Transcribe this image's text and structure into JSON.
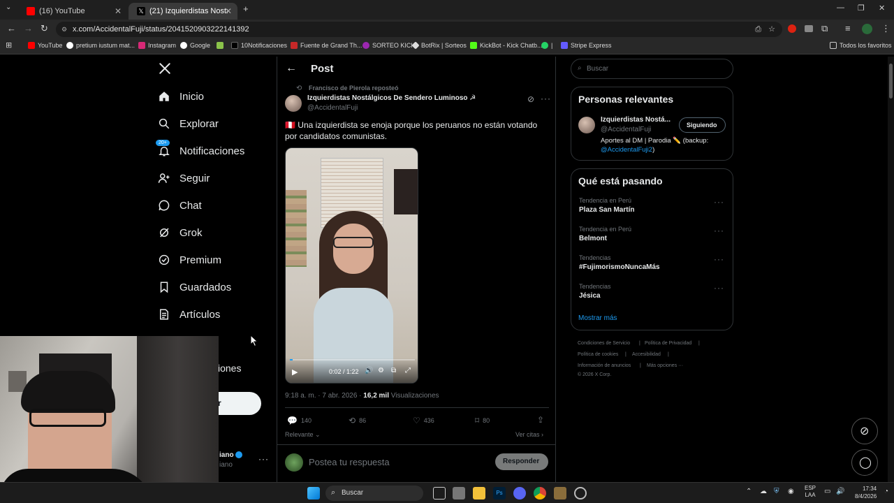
{
  "tabs": [
    {
      "label": "(16) YouTube",
      "active": false
    },
    {
      "label": "(21) Izquierdistas Nostálgicos D",
      "active": true
    }
  ],
  "address": {
    "url": "x.com/AccidentalFuji/status/2041520903222141392"
  },
  "bookmarks": [
    "YouTube",
    "pretium iustum mat...",
    "Instagram",
    "Google",
    "10Notificaciones",
    "Fuente de Grand Th...",
    "SORTEO KICK",
    "BotRix | Sorteos",
    "KickBot - Kick Chatb...",
    "|",
    "Stripe Express",
    "Todos los favoritos"
  ],
  "sidebar": {
    "items": [
      {
        "label": "Inicio",
        "icon": "home-icon"
      },
      {
        "label": "Explorar",
        "icon": "search-icon"
      },
      {
        "label": "Notificaciones",
        "icon": "bell-icon",
        "badge": "20+"
      },
      {
        "label": "Seguir",
        "icon": "follow-icon"
      },
      {
        "label": "Chat",
        "icon": "chat-icon"
      },
      {
        "label": "Grok",
        "icon": "grok-icon"
      },
      {
        "label": "Premium",
        "icon": "premium-icon"
      },
      {
        "label": "Guardados",
        "icon": "bookmark-icon"
      },
      {
        "label": "Artículos",
        "icon": "article-icon"
      }
    ],
    "partial_more": "iones",
    "partial_post": "r",
    "partial_user_name": "iano",
    "partial_user_handle": "iano"
  },
  "post": {
    "header_title": "Post",
    "reposted_by": "Francisco de Pierola reposteó",
    "author_name": "Izquierdistas Nostálgicos De Sendero Luminoso ☭",
    "author_handle": "@AccidentalFuji",
    "text": "🇵🇪 Una izquierdista se enoja porque los peruanos no están votando por candidatos comunistas.",
    "video_time": "0:02 / 1:22",
    "video_progress": 0.025,
    "timestamp": "9:18 a. m. · 7 abr. 2026 · ",
    "views_count": "16,2 mil",
    "views_label": " Visualizaciones",
    "replies": "140",
    "reposts": "86",
    "likes": "436",
    "bookmarks": "80",
    "sort_label": "Relevante",
    "quotes_label": "Ver citas",
    "reply_placeholder": "Postea tu respuesta",
    "reply_button": "Responder"
  },
  "right": {
    "search_placeholder": "Buscar",
    "relevant_title": "Personas relevantes",
    "relevant_name": "Izquierdistas Nostá...",
    "relevant_handle": "@AccidentalFuji",
    "relevant_button": "Siguiendo",
    "relevant_bio": "Aportes al DM | Parodia ✏️ (backup: ",
    "relevant_bio_link": "@AccidentalFuji2",
    "relevant_bio_end": ")",
    "trends_title": "Qué está pasando",
    "trends": [
      {
        "category": "Tendencia en Perú",
        "name": "Plaza San Martín"
      },
      {
        "category": "Tendencia en Perú",
        "name": "Belmont"
      },
      {
        "category": "Tendencias",
        "name": "#FujimorismoNuncaMás"
      },
      {
        "category": "Tendencias",
        "name": "Jésica"
      }
    ],
    "show_more": "Mostrar más",
    "footer": [
      "Condiciones de Servicio",
      "Política de Privacidad",
      "Política de cookies",
      "Accesibilidad",
      "Información de anuncios",
      "Más opciones ···",
      "© 2026 X Corp."
    ]
  },
  "taskbar": {
    "search": "Buscar",
    "lang": "ESP",
    "lang2": "LAA",
    "time": "17:34",
    "date": "8/4/2026"
  },
  "colors": {
    "accent": "#1d9bf0",
    "bg": "#000000",
    "border": "#2f3336",
    "muted": "#71767b"
  }
}
